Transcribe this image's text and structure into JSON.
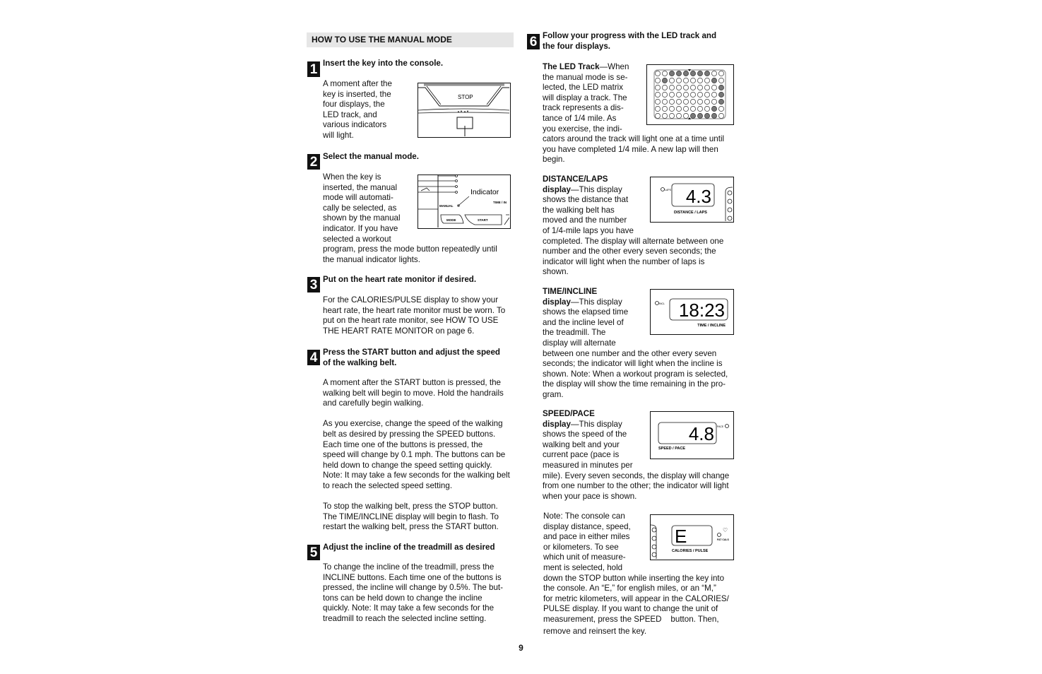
{
  "page_number": "9",
  "section_header": "HOW TO USE THE MANUAL MODE",
  "steps": [
    {
      "number": "1",
      "title": "Insert the key into the console.",
      "body": [
        "A moment after the",
        "key is inserted, the",
        "four displays, the",
        "LED track, and",
        "various indicators",
        "will light."
      ]
    },
    {
      "number": "2",
      "title": "Select the manual mode.",
      "body": [
        "When the key is",
        "inserted, the manual",
        "mode will automati-",
        "cally be selected, as",
        "shown by the manual",
        "indicator. If you have",
        "selected a workout",
        "program, press the mode button repeatedly until",
        "the manual indicator lights."
      ]
    },
    {
      "number": "3",
      "title": "Put on the heart rate monitor if desired.",
      "body": [
        "For the CALORIES/PULSE display to show your",
        "heart rate, the heart rate monitor must be worn. To",
        "put on the heart rate monitor, see HOW TO USE",
        "THE HEART RATE MONITOR on page 6."
      ]
    },
    {
      "number": "4",
      "title": [
        "Press the START button and adjust the speed",
        "of the walking belt."
      ],
      "paragraphs": [
        [
          "A moment after the START button is pressed, the",
          "walking belt will begin to move. Hold the handrails",
          "and carefully begin walking."
        ],
        [
          "As you exercise, change the speed of the walking",
          "belt as desired by pressing the SPEED buttons.",
          "Each time one of the buttons is pressed, the",
          "speed will change by 0.1 mph. The buttons can be",
          "held down to change the speed setting quickly.",
          "Note: It may take a few seconds for the walking belt",
          "to reach the selected speed setting."
        ],
        [
          "To stop the walking belt, press the STOP button.",
          "The TIME/INCLINE display will begin to flash. To",
          "restart the walking belt, press the START button."
        ]
      ]
    },
    {
      "number": "5",
      "title": "Adjust the incline of the treadmill as desired",
      "body": [
        "To change the incline of the treadmill, press the",
        "INCLINE buttons. Each time one of the buttons is",
        "pressed, the incline will change by 0.5%. The but-",
        "tons can be held down to change the incline",
        "quickly. Note: It may take a few seconds for the",
        "treadmill to reach the selected incline setting."
      ]
    },
    {
      "number": "6",
      "title": [
        "Follow your progress with the LED track and",
        "the four displays."
      ]
    }
  ],
  "figures": {
    "console": {
      "stop_label": "STOP"
    },
    "manual": {
      "indicator_label": "Indicator",
      "manual_label": "MANUAL",
      "mode_label": "MODE",
      "start_label": "START",
      "time_label": "TIME / IN"
    },
    "led_track": {
      "rows": 7,
      "cols": 10,
      "lit": [
        [
          0,
          2
        ],
        [
          0,
          3
        ],
        [
          0,
          4
        ],
        [
          0,
          5
        ],
        [
          0,
          6
        ],
        [
          0,
          7
        ],
        [
          1,
          1
        ],
        [
          1,
          8
        ],
        [
          2,
          9
        ],
        [
          3,
          9
        ],
        [
          4,
          9
        ],
        [
          5,
          8
        ],
        [
          6,
          5
        ],
        [
          6,
          6
        ],
        [
          6,
          7
        ],
        [
          6,
          8
        ]
      ]
    },
    "distance": {
      "value": "4.3",
      "label": "DISTANCE / LAPS",
      "indicator": "LAPS"
    },
    "time": {
      "value": "18:23",
      "label": "TIME / INCLINE",
      "indicator": "INCL"
    },
    "speed": {
      "value": "4.8",
      "label": "SPEED / PACE",
      "indicator": "PACE"
    },
    "calories": {
      "value": "E",
      "label": "CALORIES / PULSE",
      "indicator": "FAT CALS"
    }
  },
  "displays": {
    "led": {
      "title": "The LED Track",
      "dash": "—When",
      "lines_narrow": [
        "the manual mode is se-",
        "lected, the LED matrix",
        "will display a track. The",
        "track represents a dis-",
        "tance of 1/4 mile. As",
        "you exercise, the indi-"
      ],
      "lines_wide": [
        "cators around the track will light one at a time until",
        "you have completed 1/4 mile. A new lap will then",
        "begin."
      ]
    },
    "distance": {
      "title": "DISTANCE/LAPS",
      "sub": "display",
      "dash": "—This display",
      "lines_narrow": [
        "shows the distance that",
        "the walking belt has",
        "moved and the number",
        "of 1/4-mile laps you have"
      ],
      "lines_wide": [
        "completed. The display will alternate between one",
        "number and the other every seven seconds; the",
        "indicator will light when the number of laps is",
        "shown."
      ]
    },
    "time": {
      "title": "TIME/INCLINE",
      "sub": "display",
      "dash": "—This display",
      "lines_narrow": [
        "shows the elapsed time",
        "and the incline level of",
        "the treadmill. The",
        "display will alternate"
      ],
      "lines_wide": [
        "between one number and the other every seven",
        "seconds; the indicator will light when the incline is",
        "shown. Note: When a workout program is selected,",
        "the display will show the time remaining in the pro-",
        "gram."
      ]
    },
    "speed": {
      "title": "SPEED/PACE",
      "sub": "display",
      "dash": "—This display",
      "lines_narrow": [
        "shows the speed of the",
        "walking belt and your",
        "current pace (pace is",
        "measured in minutes per"
      ],
      "lines_wide": [
        "mile). Every seven seconds, the display will change",
        "from one number to the other; the indicator will light",
        "when your pace is shown."
      ]
    },
    "note": {
      "lines_narrow": [
        "Note: The console can",
        "display distance, speed,",
        "and pace in either miles",
        "or kilometers. To see",
        "which unit of measure-",
        "ment is selected, hold"
      ],
      "lines_wide": [
        "down the STOP button while inserting the key into",
        "the console. An “E,” for english miles, or an “M,”",
        "for metric kilometers, will appear in the CALORIES/",
        "PULSE display. If you want to change the unit of",
        "measurement, press the SPEED    button. Then,",
        "remove and reinsert the key."
      ]
    }
  }
}
